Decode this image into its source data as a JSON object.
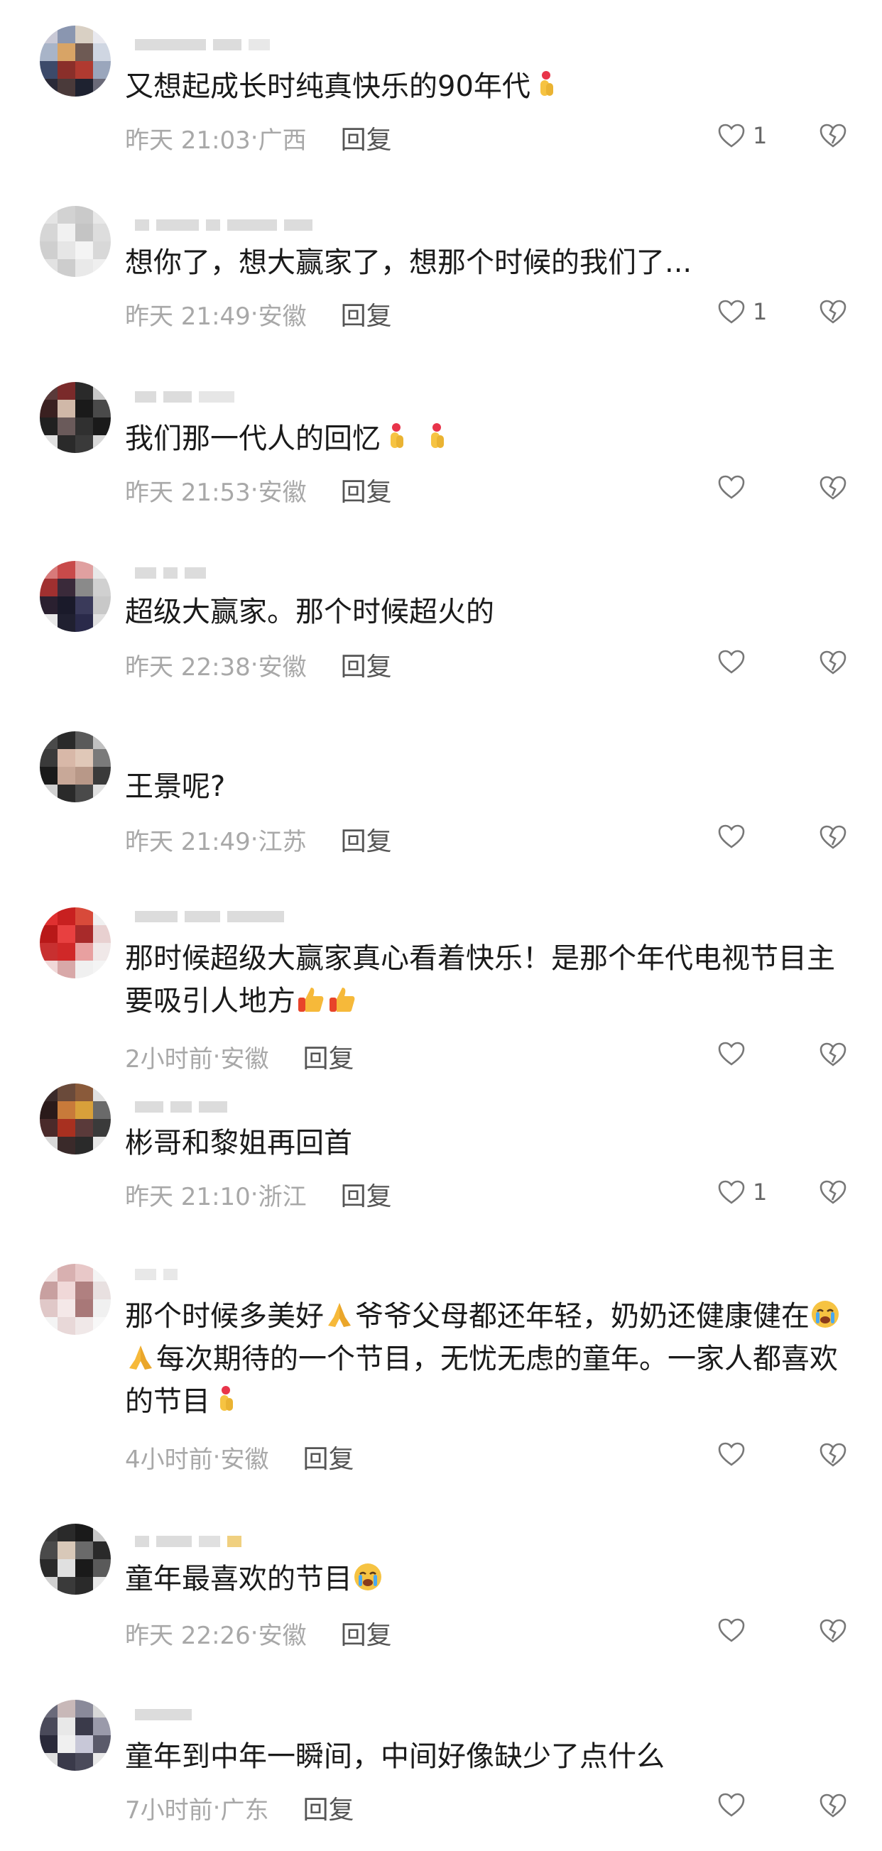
{
  "comments": [
    {
      "text": "又想起成长时纯真快乐的90年代",
      "emojis": [
        "finger-heart"
      ],
      "time": "昨天 21:03",
      "location": "广西",
      "reply": "回复",
      "likes": "1"
    },
    {
      "text": "想你了，想大赢家了，想那个时候的我们了...",
      "emojis": [],
      "time": "昨天 21:49",
      "location": "安徽",
      "reply": "回复",
      "likes": "1"
    },
    {
      "text": "我们那一代人的回忆",
      "emojis": [
        "finger-heart",
        "finger-heart"
      ],
      "time": "昨天 21:53",
      "location": "安徽",
      "reply": "回复",
      "likes": ""
    },
    {
      "text": "超级大赢家。那个时候超火的",
      "emojis": [],
      "time": "昨天 22:38",
      "location": "安徽",
      "reply": "回复",
      "likes": ""
    },
    {
      "text": "王景呢?",
      "emojis": [],
      "time": "昨天 21:49",
      "location": "江苏",
      "reply": "回复",
      "likes": ""
    },
    {
      "text": "那时候超级大赢家真心看着快乐！是那个年代电视节目主要吸引人地方",
      "emojis": [
        "thumbs-up",
        "thumbs-up"
      ],
      "time": "2小时前",
      "location": "安徽",
      "reply": "回复",
      "likes": ""
    },
    {
      "text": "彬哥和黎姐再回首",
      "emojis": [],
      "time": "昨天 21:10",
      "location": "浙江",
      "reply": "回复",
      "likes": "1"
    },
    {
      "text_parts": [
        "那个时候多美好",
        "爷爷父母都还年轻，奶奶还健康健在",
        "每次期待的一个节目，无忧无虑的童年。一家人都喜欢的节目"
      ],
      "emojis": [
        "pray",
        "crying",
        "pray",
        "finger-heart"
      ],
      "time": "4小时前",
      "location": "安徽",
      "reply": "回复",
      "likes": ""
    },
    {
      "text": "童年最喜欢的节目",
      "emojis": [
        "crying"
      ],
      "time": "昨天 22:26",
      "location": "安徽",
      "reply": "回复",
      "likes": ""
    },
    {
      "text": "童年到中年一瞬间，中间好像缺少了点什么",
      "emojis": [],
      "time": "7小时前",
      "location": "广东",
      "reply": "回复",
      "likes": ""
    }
  ],
  "icons": {
    "like": "heart-outline-icon",
    "dislike": "broken-heart-icon"
  },
  "colors": {
    "meta": "#a8a8a8",
    "reply": "#555555",
    "text": "#1a1a1a"
  }
}
